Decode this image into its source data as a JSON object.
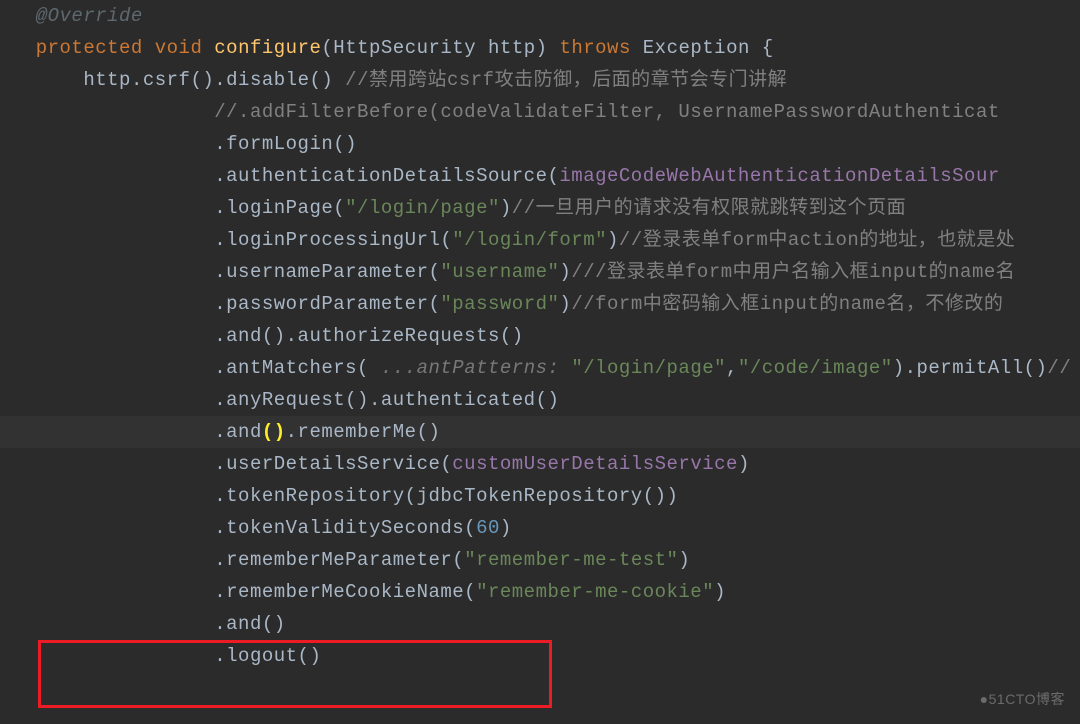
{
  "code": {
    "line1_annotation": "@Override",
    "line2_protected": "protected",
    "line2_void": "void",
    "line2_configure": "configure",
    "line2_params": "(HttpSecurity http)",
    "line2_throws": "throws",
    "line2_exception": "Exception {",
    "line3_http": "    http",
    "line3_csrf": ".csrf().disable() ",
    "line3_comment": "//禁用跨站csrf攻击防御，后面的章节会专门讲解",
    "line4_comment": "//.addFilterBefore(codeValidateFilter, UsernamePasswordAuthenticat",
    "line5": ".formLogin()",
    "line6_method": ".authenticationDetailsSource(",
    "line6_param": "imageCodeWebAuthenticationDetailsSour",
    "line7_method": ".loginPage(",
    "line7_string": "\"/login/page\"",
    "line7_close": ")",
    "line7_comment": "//一旦用户的请求没有权限就跳转到这个页面",
    "line8_method": ".loginProcessingUrl(",
    "line8_string": "\"/login/form\"",
    "line8_close": ")",
    "line8_comment": "//登录表单form中action的地址，也就是处",
    "line9_method": ".usernameParameter(",
    "line9_string": "\"username\"",
    "line9_close": ")",
    "line9_comment": "///登录表单form中用户名输入框input的name名",
    "line10_method": ".passwordParameter(",
    "line10_string": "\"password\"",
    "line10_close": ")",
    "line10_comment": "//form中密码输入框input的name名，不修改的",
    "line11": ".and().authorizeRequests()",
    "line12_method": ".antMatchers( ",
    "line12_hint": "...antPatterns: ",
    "line12_string1": "\"/login/page\"",
    "line12_comma": ",",
    "line12_string2": "\"/code/image\"",
    "line12_close": ").permitAll()",
    "line12_comment": "//",
    "line13": ".anyRequest().authenticated()",
    "line14_and": ".and",
    "line14_paren": "()",
    "line14_rest": ".rememberMe()",
    "line15_method": ".userDetailsService(",
    "line15_param": "customUserDetailsService",
    "line15_close": ")",
    "line16": ".tokenRepository(jdbcTokenRepository())",
    "line17_method": ".tokenValiditySeconds(",
    "line17_number": "60",
    "line17_close": ")",
    "line18_method": ".rememberMeParameter(",
    "line18_string": "\"remember-me-test\"",
    "line18_close": ")",
    "line19_method": ".rememberMeCookieName(",
    "line19_string": "\"remember-me-cookie\"",
    "line19_close": ")",
    "line20": ".and()",
    "line21": ".logout()"
  },
  "indent_base": "   ",
  "indent_method": "                  ",
  "watermark": "●51CTO博客"
}
